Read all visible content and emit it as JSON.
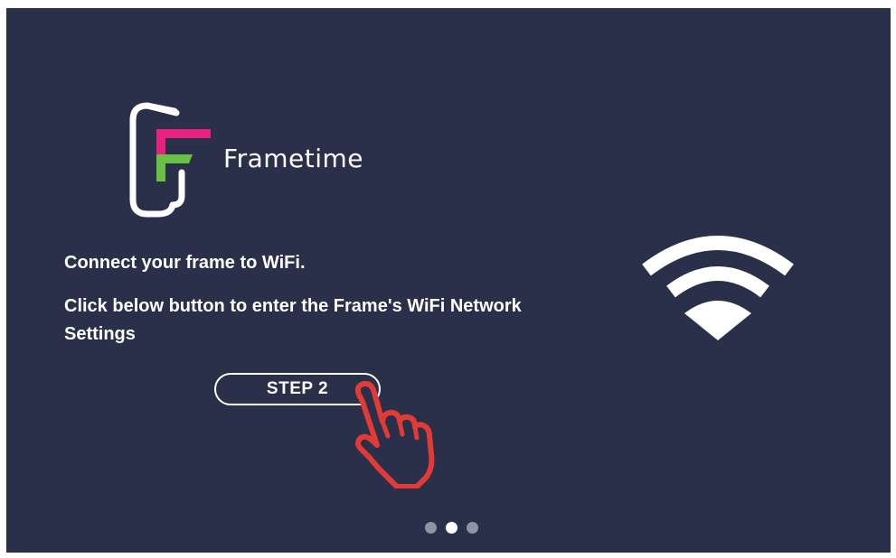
{
  "app": {
    "brand_name": "Frametime",
    "logo_colors": {
      "magenta": "#e8207e",
      "green": "#6ac044",
      "frame": "#ffffff"
    },
    "background_color": "#2a2f4a"
  },
  "content": {
    "line1": "Connect your frame to WiFi.",
    "line2": "Click below button to enter the Frame's WiFi Network Settings"
  },
  "step_button": {
    "label": "STEP 2"
  },
  "icons": {
    "pointer": "hand-pointer-icon",
    "wifi": "wifi-icon",
    "pointer_color": "#e23b36"
  },
  "pager": {
    "total": 3,
    "active_index": 1
  }
}
